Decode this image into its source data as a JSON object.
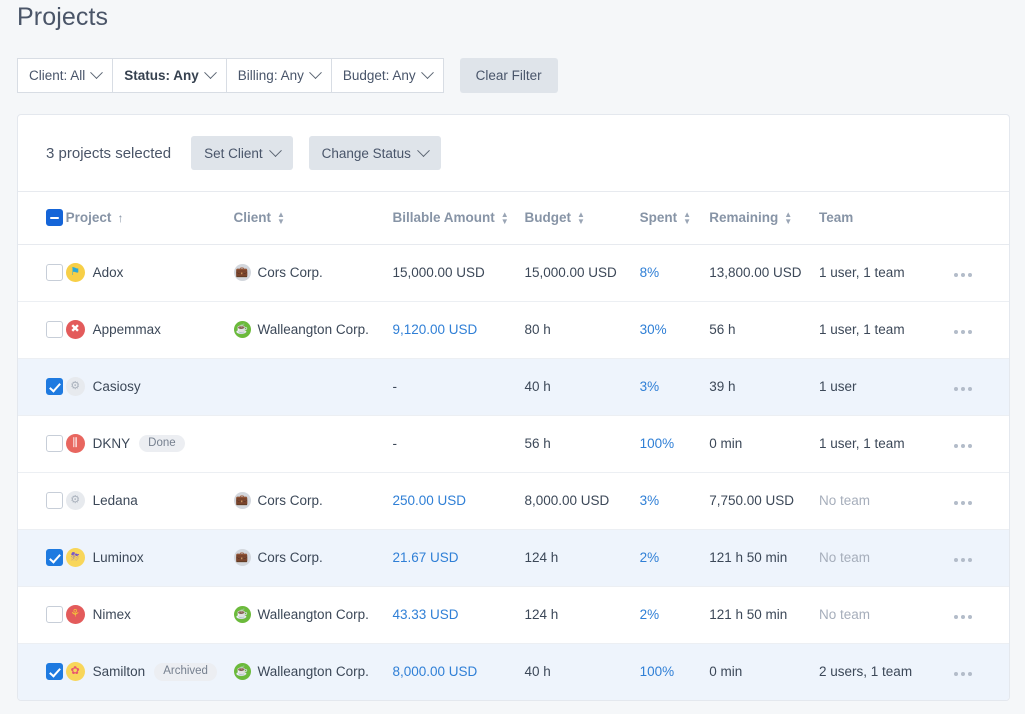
{
  "page": {
    "title": "Projects"
  },
  "filters": {
    "items": [
      {
        "label": "Client: All",
        "bold": false
      },
      {
        "label": "Status: Any",
        "bold": true
      },
      {
        "label": "Billing: Any",
        "bold": false
      },
      {
        "label": "Budget: Any",
        "bold": false
      }
    ],
    "clear_label": "Clear Filter"
  },
  "bulk": {
    "count_label": "3 projects selected",
    "set_client_label": "Set Client",
    "change_status_label": "Change Status"
  },
  "table": {
    "columns": [
      {
        "label": "Project",
        "sortable": true,
        "sorted": "asc",
        "sort_glyph": "↑"
      },
      {
        "label": "Client",
        "sortable": true,
        "sorted": ""
      },
      {
        "label": "Billable Amount",
        "sortable": true,
        "sorted": ""
      },
      {
        "label": "Budget",
        "sortable": true,
        "sorted": ""
      },
      {
        "label": "Spent",
        "sortable": true,
        "sorted": ""
      },
      {
        "label": "Remaining",
        "sortable": true,
        "sorted": ""
      },
      {
        "label": "Team",
        "sortable": false,
        "sorted": ""
      }
    ],
    "rows": [
      {
        "selected": false,
        "project": "Adox",
        "badge": "",
        "icon": "flag-icon",
        "client": "Cors Corp.",
        "client_icon": "briefcase-icon",
        "billable": "15,000.00 USD",
        "billable_link": false,
        "budget": "15,000.00 USD",
        "spent": "8%",
        "remaining": "13,800.00 USD",
        "team": "1 user, 1 team",
        "team_muted": false
      },
      {
        "selected": false,
        "project": "Appemmax",
        "badge": "",
        "icon": "bone-icon",
        "client": "Walleangton Corp.",
        "client_icon": "cup-icon",
        "billable": "9,120.00 USD",
        "billable_link": true,
        "budget": "80 h",
        "spent": "30%",
        "remaining": "56 h",
        "team": "1 user, 1 team",
        "team_muted": false
      },
      {
        "selected": true,
        "project": "Casiosy",
        "badge": "",
        "icon": "gear-icon",
        "client": "",
        "client_icon": "",
        "billable": "-",
        "billable_link": false,
        "budget": "40 h",
        "spent": "3%",
        "remaining": "39 h",
        "team": "1 user",
        "team_muted": false
      },
      {
        "selected": false,
        "project": "DKNY",
        "badge": "Done",
        "icon": "palette-icon",
        "client": "",
        "client_icon": "",
        "billable": "-",
        "billable_link": false,
        "budget": "56 h",
        "spent": "100%",
        "remaining": "0 min",
        "team": "1 user, 1 team",
        "team_muted": false
      },
      {
        "selected": false,
        "project": "Ledana",
        "badge": "",
        "icon": "gear-icon",
        "client": "Cors Corp.",
        "client_icon": "briefcase-icon",
        "billable": "250.00 USD",
        "billable_link": true,
        "budget": "8,000.00 USD",
        "spent": "3%",
        "remaining": "7,750.00 USD",
        "team": "No team",
        "team_muted": true
      },
      {
        "selected": true,
        "project": "Luminox",
        "badge": "",
        "icon": "storm-cloud-icon",
        "client": "Cors Corp.",
        "client_icon": "briefcase-icon",
        "billable": "21.67 USD",
        "billable_link": true,
        "budget": "124 h",
        "spent": "2%",
        "remaining": "121 h 50 min",
        "team": "No team",
        "team_muted": true
      },
      {
        "selected": false,
        "project": "Nimex",
        "badge": "",
        "icon": "leaf-icon",
        "client": "Walleangton Corp.",
        "client_icon": "cup-icon",
        "billable": "43.33 USD",
        "billable_link": true,
        "budget": "124 h",
        "spent": "2%",
        "remaining": "121 h 50 min",
        "team": "No team",
        "team_muted": true
      },
      {
        "selected": true,
        "project": "Samilton",
        "badge": "Archived",
        "icon": "flower-icon",
        "client": "Walleangton Corp.",
        "client_icon": "cup-icon",
        "billable": "8,000.00 USD",
        "billable_link": true,
        "budget": "40 h",
        "spent": "100%",
        "remaining": "0 min",
        "team": "2 users, 1 team",
        "team_muted": false
      }
    ],
    "row_menu_icon": "more-options-icon",
    "header_checkbox_state": "indeterminate"
  },
  "colors": {
    "link": "#2f7fd6",
    "checkbox_checked": "#1e7ae0",
    "selected_row_bg": "#eef4fc",
    "page_bg": "#f5f7f9"
  }
}
